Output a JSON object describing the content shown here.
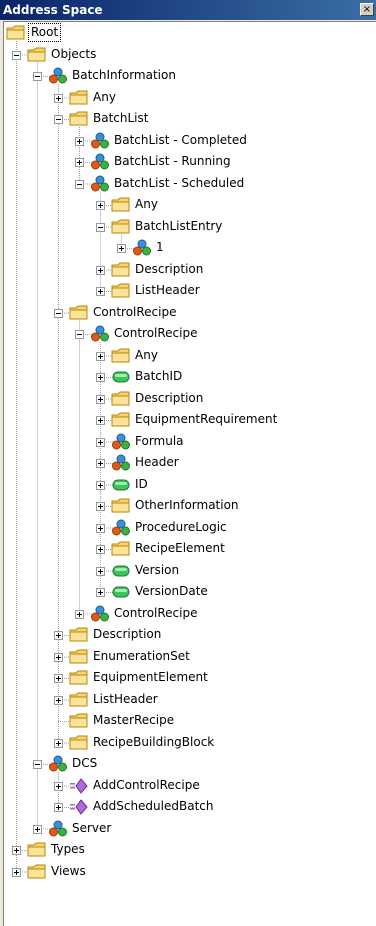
{
  "window": {
    "title": "Address Space",
    "close_label": "×"
  },
  "tree": [
    {
      "label": "Root",
      "depth": 0,
      "icon": "folder-icon",
      "toggle": null,
      "selected": true
    },
    {
      "label": "Objects",
      "depth": 1,
      "icon": "folder-icon",
      "toggle": "minus"
    },
    {
      "label": "BatchInformation",
      "depth": 2,
      "icon": "object-node-icon",
      "toggle": "minus"
    },
    {
      "label": "Any",
      "depth": 3,
      "icon": "folder-icon",
      "toggle": "plus"
    },
    {
      "label": "BatchList",
      "depth": 3,
      "icon": "folder-icon",
      "toggle": "minus"
    },
    {
      "label": "BatchList - Completed",
      "depth": 4,
      "icon": "object-node-icon",
      "toggle": "plus"
    },
    {
      "label": "BatchList - Running",
      "depth": 4,
      "icon": "object-node-icon",
      "toggle": "plus"
    },
    {
      "label": "BatchList - Scheduled",
      "depth": 4,
      "icon": "object-node-icon",
      "toggle": "minus"
    },
    {
      "label": "Any",
      "depth": 5,
      "icon": "folder-icon",
      "toggle": "plus"
    },
    {
      "label": "BatchListEntry",
      "depth": 5,
      "icon": "folder-icon",
      "toggle": "minus"
    },
    {
      "label": "1",
      "depth": 6,
      "icon": "object-node-icon",
      "toggle": "plus"
    },
    {
      "label": "Description",
      "depth": 5,
      "icon": "folder-icon",
      "toggle": "plus"
    },
    {
      "label": "ListHeader",
      "depth": 5,
      "icon": "folder-icon",
      "toggle": "plus"
    },
    {
      "label": "ControlRecipe",
      "depth": 3,
      "icon": "folder-icon",
      "toggle": "minus"
    },
    {
      "label": "ControlRecipe",
      "depth": 4,
      "icon": "object-node-icon",
      "toggle": "minus"
    },
    {
      "label": "Any",
      "depth": 5,
      "icon": "folder-icon",
      "toggle": "plus"
    },
    {
      "label": "BatchID",
      "depth": 5,
      "icon": "variable-node-icon",
      "toggle": "plus"
    },
    {
      "label": "Description",
      "depth": 5,
      "icon": "folder-icon",
      "toggle": "plus"
    },
    {
      "label": "EquipmentRequirement",
      "depth": 5,
      "icon": "folder-icon",
      "toggle": "plus"
    },
    {
      "label": "Formula",
      "depth": 5,
      "icon": "object-node-icon",
      "toggle": "plus"
    },
    {
      "label": "Header",
      "depth": 5,
      "icon": "object-node-icon",
      "toggle": "plus"
    },
    {
      "label": "ID",
      "depth": 5,
      "icon": "variable-node-icon",
      "toggle": "plus"
    },
    {
      "label": "OtherInformation",
      "depth": 5,
      "icon": "folder-icon",
      "toggle": "plus"
    },
    {
      "label": "ProcedureLogic",
      "depth": 5,
      "icon": "object-node-icon",
      "toggle": "plus"
    },
    {
      "label": "RecipeElement",
      "depth": 5,
      "icon": "folder-icon",
      "toggle": "plus"
    },
    {
      "label": "Version",
      "depth": 5,
      "icon": "variable-node-icon",
      "toggle": "plus"
    },
    {
      "label": "VersionDate",
      "depth": 5,
      "icon": "variable-node-icon",
      "toggle": "plus"
    },
    {
      "label": "ControlRecipe",
      "depth": 4,
      "icon": "object-node-icon",
      "toggle": "plus"
    },
    {
      "label": "Description",
      "depth": 3,
      "icon": "folder-icon",
      "toggle": "plus"
    },
    {
      "label": "EnumerationSet",
      "depth": 3,
      "icon": "folder-icon",
      "toggle": "plus"
    },
    {
      "label": "EquipmentElement",
      "depth": 3,
      "icon": "folder-icon",
      "toggle": "plus"
    },
    {
      "label": "ListHeader",
      "depth": 3,
      "icon": "folder-icon",
      "toggle": "plus"
    },
    {
      "label": "MasterRecipe",
      "depth": 3,
      "icon": "folder-icon",
      "toggle": null
    },
    {
      "label": "RecipeBuildingBlock",
      "depth": 3,
      "icon": "folder-icon",
      "toggle": "plus"
    },
    {
      "label": "DCS",
      "depth": 2,
      "icon": "object-node-icon",
      "toggle": "minus"
    },
    {
      "label": "AddControlRecipe",
      "depth": 3,
      "icon": "method-node-icon",
      "toggle": "plus"
    },
    {
      "label": "AddScheduledBatch",
      "depth": 3,
      "icon": "method-node-icon",
      "toggle": "plus"
    },
    {
      "label": "Server",
      "depth": 2,
      "icon": "object-node-icon",
      "toggle": "plus"
    },
    {
      "label": "Types",
      "depth": 1,
      "icon": "folder-icon",
      "toggle": "plus"
    },
    {
      "label": "Views",
      "depth": 1,
      "icon": "folder-icon",
      "toggle": "plus"
    }
  ]
}
